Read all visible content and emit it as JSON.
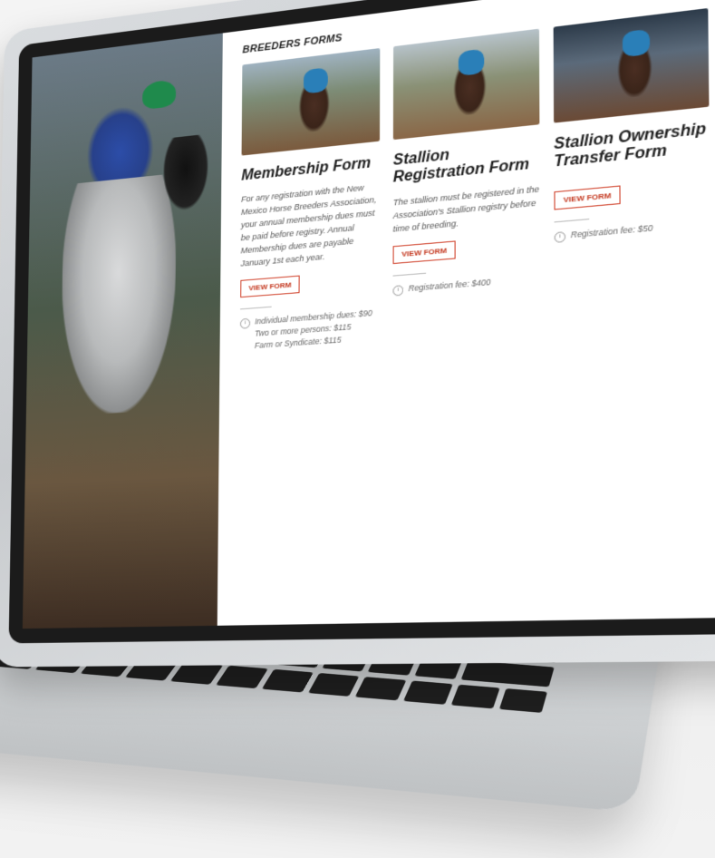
{
  "section_title": "BREEDERS FORMS",
  "forms": [
    {
      "title": "Membership Form",
      "description": "For any registration with the New Mexico Horse Breeders Association, your annual membership dues must be paid before registry. Annual Membership dues are payable January 1st each year.",
      "button_label": "VIEW FORM",
      "fees": [
        "Individual membership dues: $90",
        "Two or more persons: $115",
        "Farm or Syndicate: $115"
      ]
    },
    {
      "title": "Stallion Registration Form",
      "description": "The stallion must be registered in the Association's Stallion registry before time of breeding.",
      "button_label": "VIEW FORM",
      "fees": [
        "Registration fee: $400"
      ]
    },
    {
      "title": "Stallion Ownership Transfer Form",
      "description": "",
      "button_label": "VIEW FORM",
      "fees": [
        "Registration fee: $50"
      ]
    }
  ],
  "colors": {
    "button_accent": "#c4381f",
    "helmet_green": "#1f8a4c",
    "silks_blue": "#2c4da8"
  },
  "icons": {
    "fee": "info-circle-icon"
  }
}
